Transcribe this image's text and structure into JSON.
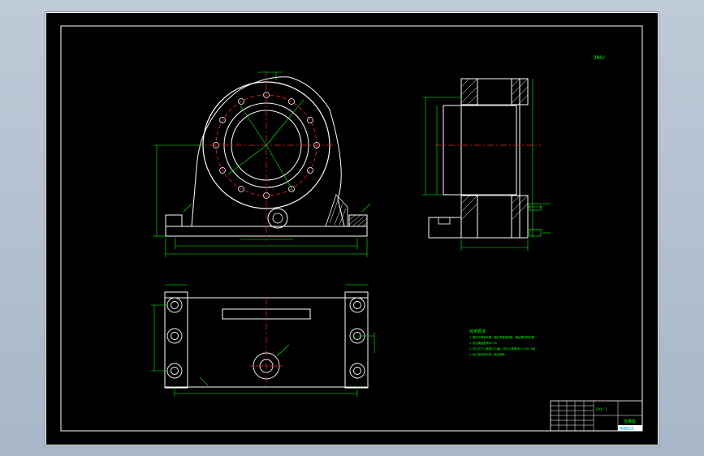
{
  "drawing": {
    "scale_note": "200/",
    "tech_requirements": {
      "title": "技术要求",
      "lines": [
        "1.铸件不得有砂眼、缩孔等铸造缺陷，铸后需时效处理",
        "2.未注铸造圆角R3~R5",
        "3.未注尺寸公差按IT14级，形位公差按GB/T1184 K级",
        "4.加工前去除毛刺、锐边倒钝"
      ]
    },
    "title_block": {
      "drawing_no": "GYY-1",
      "part_name": "支撑座",
      "company_tag": "MOBUSI"
    },
    "colors": {
      "outline": "#ffffff",
      "dimension": "#00ff00",
      "centerline": "#ff2020",
      "hatch": "#ffffff",
      "sheet": "#000000",
      "frame": "#ffffff"
    }
  }
}
